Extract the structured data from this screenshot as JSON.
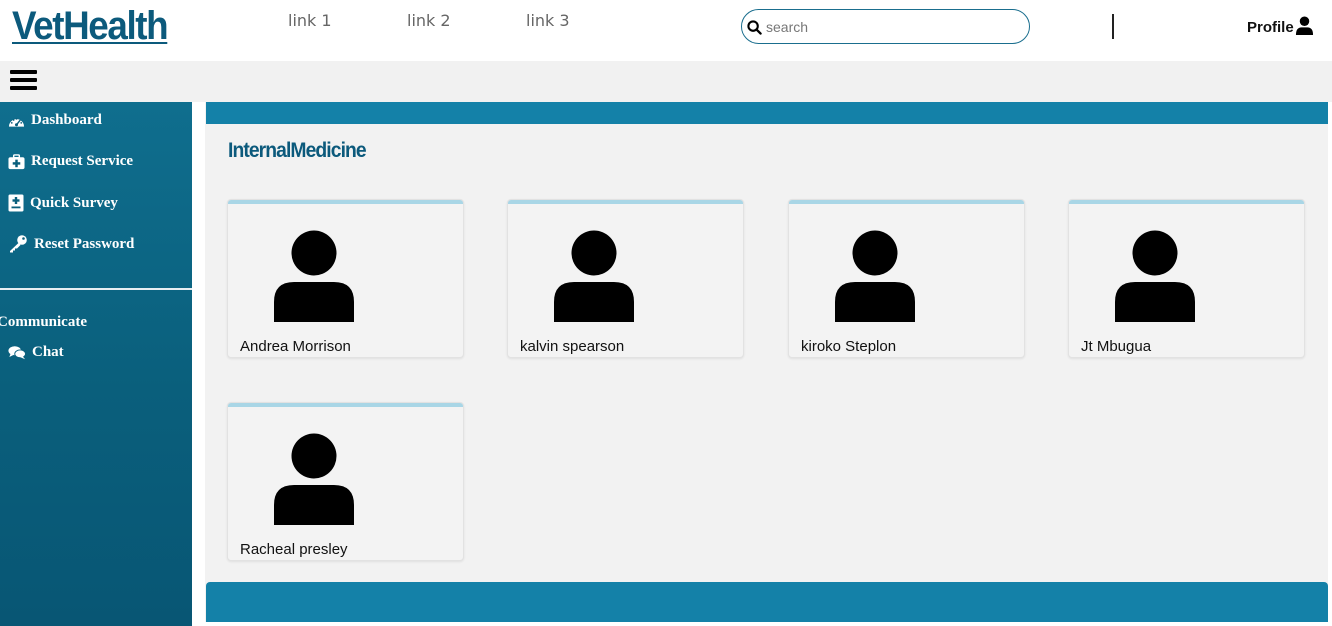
{
  "header": {
    "logo": "VetHealth",
    "nav": [
      {
        "label": "link 1"
      },
      {
        "label": "link 2"
      },
      {
        "label": "link 3"
      }
    ],
    "search": {
      "placeholder": "search",
      "value": ""
    },
    "profile_label": "Profile"
  },
  "sidebar": {
    "items": [
      {
        "label": "Dashboard",
        "icon": "dashboard-icon"
      },
      {
        "label": "Request Service",
        "icon": "medkit-icon"
      },
      {
        "label": "Quick Survey",
        "icon": "medical-file-icon"
      },
      {
        "label": "Reset Password",
        "icon": "key-icon"
      }
    ],
    "section_title": "Communicate",
    "section_items": [
      {
        "label": "Chat",
        "icon": "chat-icon"
      }
    ]
  },
  "main": {
    "title": "InternalMedicine",
    "doctors": [
      {
        "name": "Andrea Morrison",
        "icon": "user-icon"
      },
      {
        "name": "kalvin spearson",
        "icon": "user-icon"
      },
      {
        "name": "kiroko Steplon",
        "icon": "user-icon"
      },
      {
        "name": "Jt Mbugua",
        "icon": "user-icon"
      },
      {
        "name": "Racheal presley",
        "icon": "user-icon"
      }
    ]
  },
  "colors": {
    "brand": "#0c5a7c",
    "sidebar": "#0a5f7c",
    "accent_bar": "#1481a8",
    "card_top": "#a9d6e6",
    "panel": "#f2f2f2"
  }
}
